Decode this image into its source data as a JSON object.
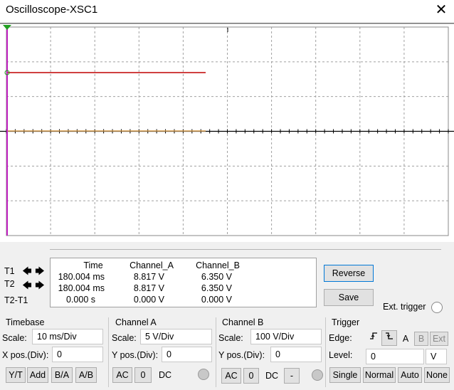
{
  "window": {
    "title": "Oscilloscope-XSC1"
  },
  "colors": {
    "channel_a": "#c00000",
    "channel_b": "#d9a050",
    "cursor": "#c020c0",
    "grid": "#a0a0a0",
    "axis": "#000000"
  },
  "readout": {
    "headers": {
      "time": "Time",
      "channel_a": "Channel_A",
      "channel_b": "Channel_B"
    },
    "rows": [
      {
        "label": "T1",
        "time": "180.004 ms",
        "a": "8.817 V",
        "b": "6.350 V"
      },
      {
        "label": "T2",
        "time": "180.004 ms",
        "a": "8.817 V",
        "b": "6.350 V"
      },
      {
        "label": "T2-T1",
        "time": "0.000 s",
        "a": "0.000 V",
        "b": "0.000 V"
      }
    ],
    "reverse_label": "Reverse",
    "save_label": "Save",
    "ext_trigger_label": "Ext. trigger"
  },
  "timebase": {
    "title": "Timebase",
    "scale_label": "Scale:",
    "scale_value": "10 ms/Div",
    "xpos_label": "X pos.(Div):",
    "xpos_value": "0",
    "buttons": [
      "Y/T",
      "Add",
      "B/A",
      "A/B"
    ]
  },
  "channel_a": {
    "title": "Channel A",
    "scale_label": "Scale:",
    "scale_value": "5  V/Div",
    "ypos_label": "Y pos.(Div):",
    "ypos_value": "0",
    "buttons": [
      "AC",
      "0",
      "DC"
    ]
  },
  "channel_b": {
    "title": "Channel B",
    "scale_label": "Scale:",
    "scale_value": "100  V/Div",
    "ypos_label": "Y pos.(Div):",
    "ypos_value": "0",
    "buttons": [
      "AC",
      "0",
      "DC",
      "-"
    ]
  },
  "trigger": {
    "title": "Trigger",
    "edge_label": "Edge:",
    "level_label": "Level:",
    "level_value": "0",
    "level_unit": "V",
    "edge_buttons": [
      "A",
      "B",
      "Ext"
    ],
    "mode_buttons": [
      "Single",
      "Normal",
      "Auto",
      "None"
    ]
  }
}
